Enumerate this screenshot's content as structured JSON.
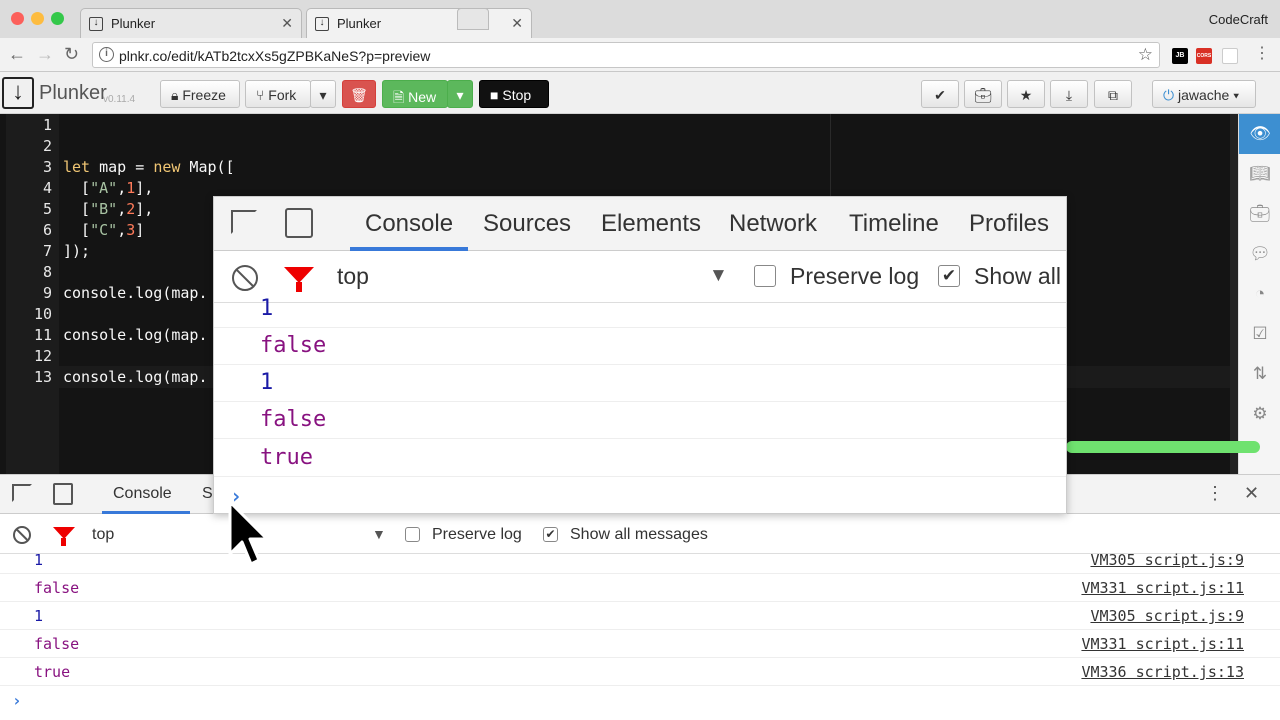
{
  "browser": {
    "tabs": [
      {
        "title": "Plunker"
      },
      {
        "title": "Plunker"
      }
    ],
    "profile_name": "CodeCraft",
    "url": "plnkr.co/edit/kATb2tcxXs5gZPBKaNeS?p=preview",
    "extensions": [
      {
        "name": "jetbrains-extension-icon",
        "label": "JB",
        "color": "#000000"
      },
      {
        "name": "cors-extension-icon",
        "label": "CORS",
        "color": "#d93025"
      }
    ]
  },
  "plunker": {
    "logo_text": "Plunker",
    "version": "v0.11.4",
    "buttons": {
      "freeze": "Freeze",
      "fork": "Fork",
      "new": "New",
      "stop": "Stop"
    },
    "user": "jawache"
  },
  "editor": {
    "line_numbers": [
      "1",
      "2",
      "3",
      "4",
      "5",
      "6",
      "7",
      "8",
      "9",
      "10",
      "11",
      "12",
      "13"
    ]
  },
  "devtools": {
    "tabs": [
      "Console",
      "Sources",
      "Elements",
      "Network",
      "Timeline",
      "Profiles"
    ],
    "bottom_tabs": [
      "Console",
      "S"
    ],
    "context": "top",
    "preserve_log": "Preserve log",
    "show_all_messages": "Show all messages",
    "show_all_zoomed": "Show all",
    "preserve_checked": false,
    "show_all_checked": true,
    "console_rows": [
      {
        "value": "1",
        "source": "VM305 script.js:9"
      },
      {
        "value": "false",
        "source": "VM331 script.js:11"
      },
      {
        "value": "1",
        "source": "VM305 script.js:9"
      },
      {
        "value": "false",
        "source": "VM331 script.js:11"
      },
      {
        "value": "true",
        "source": "VM336 script.js:13"
      }
    ]
  }
}
